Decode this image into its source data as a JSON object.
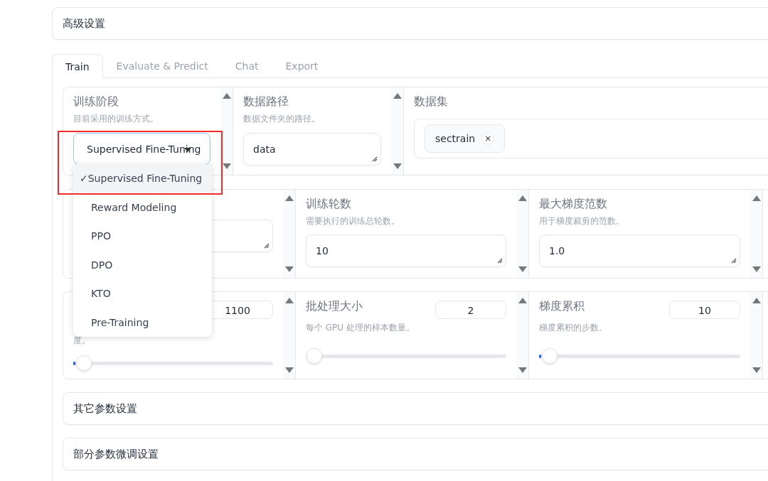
{
  "advanced_settings": {
    "title": "高级设置"
  },
  "tabs": [
    {
      "label": "Train",
      "selected": true
    },
    {
      "label": "Evaluate & Predict",
      "selected": false
    },
    {
      "label": "Chat",
      "selected": false
    },
    {
      "label": "Export",
      "selected": false
    }
  ],
  "row_1": [
    {
      "kind": "dropdown",
      "label": "训练阶段",
      "info": "目前采用的训练方式。",
      "value": "Supervised Fine-Tuning",
      "open": true,
      "check_mark": "✓",
      "options": [
        {
          "label": "Supervised Fine-Tuning",
          "selected": true
        },
        {
          "label": "Reward Modeling",
          "selected": false
        },
        {
          "label": "PPO",
          "selected": false
        },
        {
          "label": "DPO",
          "selected": false
        },
        {
          "label": "KTO",
          "selected": false
        },
        {
          "label": "Pre-Training",
          "selected": false
        }
      ]
    },
    {
      "kind": "textbox",
      "label": "数据路径",
      "info": "数据文件夹的路径。",
      "value": "data"
    },
    {
      "kind": "multiselect",
      "label": "数据集",
      "tags": [
        {
          "label": "sectrain",
          "remove": "×"
        }
      ]
    }
  ],
  "row_2": [
    {
      "kind": "textbox"
    },
    {
      "kind": "textbox",
      "label": "训练轮数",
      "info": "需要执行的训练总轮数。",
      "value": "10"
    },
    {
      "kind": "textbox",
      "label": "最大梯度范数",
      "info": "用于梯度裁剪的范数。",
      "value": "1.0"
    },
    {
      "kind": "blank"
    }
  ],
  "row_3": [
    {
      "kind": "slider",
      "info": "度。",
      "value": "1100",
      "level": 0.01
    },
    {
      "kind": "slider",
      "label": "批处理大小",
      "info": "每个 GPU 处理的样本数量。",
      "value": "2",
      "level": 0
    },
    {
      "kind": "slider",
      "label": "梯度累积",
      "info": "梯度累积的步数。",
      "value": "10",
      "level": 0.01
    },
    {
      "kind": "blank"
    }
  ],
  "accordions": [
    {
      "title": "其它参数设置"
    },
    {
      "title": "部分参数微调设置"
    }
  ]
}
